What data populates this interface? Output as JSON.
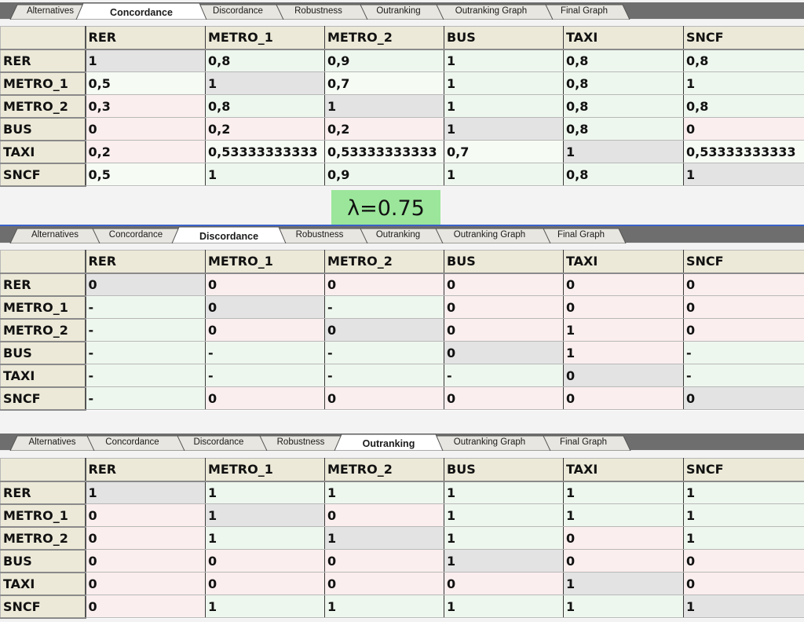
{
  "tabs": [
    "Alternatives",
    "Concordance",
    "Discordance",
    "Robustness",
    "Outranking",
    "Outranking Graph",
    "Final Graph"
  ],
  "lambda_label": "λ=0.75",
  "alternatives": [
    "RER",
    "METRO_1",
    "METRO_2",
    "BUS",
    "TAXI",
    "SNCF"
  ],
  "panels": [
    {
      "active_tab": "Concordance",
      "rows": [
        [
          "1",
          "0,8",
          "0,9",
          "1",
          "0,8",
          "0,8"
        ],
        [
          "0,5",
          "1",
          "0,7",
          "1",
          "0,8",
          "1"
        ],
        [
          "0,3",
          "0,8",
          "1",
          "1",
          "0,8",
          "0,8"
        ],
        [
          "0",
          "0,2",
          "0,2",
          "1",
          "0,8",
          "0"
        ],
        [
          "0,2",
          "0,53333333333",
          "0,53333333333",
          "0,7",
          "1",
          "0,53333333333"
        ],
        [
          "0,5",
          "1",
          "0,9",
          "1",
          "0,8",
          "1"
        ]
      ]
    },
    {
      "active_tab": "Discordance",
      "rows": [
        [
          "0",
          "0",
          "0",
          "0",
          "0",
          "0"
        ],
        [
          "-",
          "0",
          "-",
          "0",
          "0",
          "0"
        ],
        [
          "-",
          "0",
          "0",
          "0",
          "1",
          "0"
        ],
        [
          "-",
          "-",
          "-",
          "0",
          "1",
          "-"
        ],
        [
          "-",
          "-",
          "-",
          "-",
          "0",
          "-"
        ],
        [
          "-",
          "0",
          "0",
          "0",
          "0",
          "0"
        ]
      ]
    },
    {
      "active_tab": "Outranking",
      "rows": [
        [
          "1",
          "1",
          "1",
          "1",
          "1",
          "1"
        ],
        [
          "0",
          "1",
          "0",
          "1",
          "1",
          "1"
        ],
        [
          "0",
          "1",
          "1",
          "1",
          "0",
          "1"
        ],
        [
          "0",
          "0",
          "0",
          "1",
          "0",
          "0"
        ],
        [
          "0",
          "0",
          "0",
          "0",
          "1",
          "0"
        ],
        [
          "0",
          "1",
          "1",
          "1",
          "1",
          "1"
        ]
      ]
    }
  ],
  "colors": {
    "true_cell": "#eef7ee",
    "false_cell": "#fbeeee",
    "diagonal_cell": "#e3e3e3",
    "lambda_badge": "#9be69b",
    "tabbar": "#6e6e6e",
    "tab": "#e8e6e0"
  }
}
